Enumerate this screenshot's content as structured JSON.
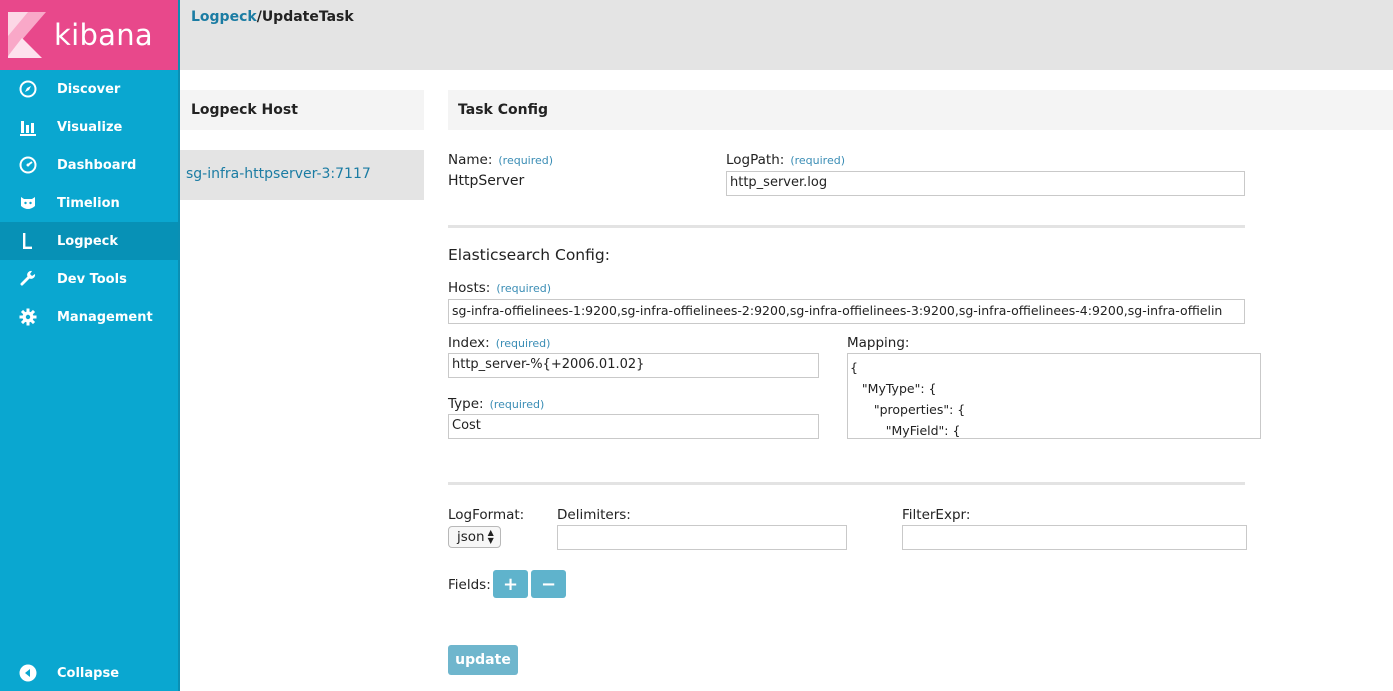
{
  "app": {
    "name": "kibana"
  },
  "nav": {
    "items": [
      {
        "label": "Discover",
        "icon": "compass-icon"
      },
      {
        "label": "Visualize",
        "icon": "bar-chart-icon"
      },
      {
        "label": "Dashboard",
        "icon": "dashboard-icon"
      },
      {
        "label": "Timelion",
        "icon": "timelion-icon"
      },
      {
        "label": "Logpeck",
        "icon": "logpeck-icon",
        "active": true
      },
      {
        "label": "Dev Tools",
        "icon": "wrench-icon"
      },
      {
        "label": "Management",
        "icon": "gear-icon"
      }
    ],
    "collapse_label": "Collapse"
  },
  "breadcrumb": {
    "link": "Logpeck",
    "separator": "/",
    "current": "UpdateTask"
  },
  "host_panel": {
    "title": "Logpeck Host",
    "hosts": [
      "sg-infra-httpserver-3:7117"
    ]
  },
  "task_config": {
    "title": "Task Config",
    "required_text": "(required)",
    "name": {
      "label": "Name:",
      "value": "HttpServer"
    },
    "logpath": {
      "label": "LogPath:",
      "value": "http_server.log"
    },
    "es_heading": "Elasticsearch Config:",
    "hosts": {
      "label": "Hosts:",
      "value": "sg-infra-offielinees-1:9200,sg-infra-offielinees-2:9200,sg-infra-offielinees-3:9200,sg-infra-offielinees-4:9200,sg-infra-offielin"
    },
    "index": {
      "label": "Index:",
      "value": "http_server-%{+2006.01.02}"
    },
    "type": {
      "label": "Type:",
      "value": "Cost"
    },
    "mapping": {
      "label": "Mapping:",
      "value": "{\n   \"MyType\": {\n      \"properties\": {\n         \"MyField\": {"
    },
    "logformat": {
      "label": "LogFormat:",
      "selected": "json"
    },
    "delimiters": {
      "label": "Delimiters:",
      "value": ""
    },
    "filterexpr": {
      "label": "FilterExpr:",
      "value": ""
    },
    "fields": {
      "label": "Fields:",
      "add": "+",
      "remove": "−"
    },
    "update_label": "update"
  },
  "colors": {
    "brand": "#e8488b",
    "sidebar": "#0aa7d0",
    "link": "#1b7ca3",
    "button": "#6fb6cd"
  }
}
